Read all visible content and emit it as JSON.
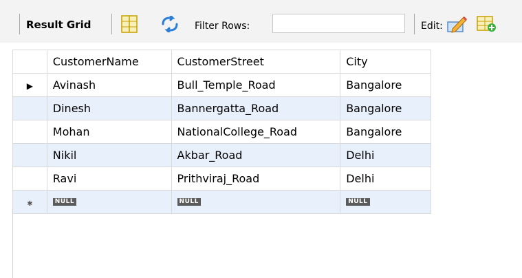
{
  "toolbar": {
    "result_grid_label": "Result Grid",
    "filter_rows_label": "Filter Rows:",
    "filter_value": "",
    "edit_label": "Edit:"
  },
  "grid": {
    "columns": [
      "CustomerName",
      "CustomerStreet",
      "City"
    ],
    "rows": [
      [
        "Avinash",
        "Bull_Temple_Road",
        "Bangalore"
      ],
      [
        "Dinesh",
        "Bannergatta_Road",
        "Bangalore"
      ],
      [
        "Mohan",
        "NationalCollege_Road",
        "Bangalore"
      ],
      [
        "Nikil",
        "Akbar_Road",
        "Delhi"
      ],
      [
        "Ravi",
        "Prithviraj_Road",
        "Delhi"
      ]
    ],
    "new_row": [
      "NULL",
      "NULL",
      "NULL"
    ],
    "current_row_marker": "▶",
    "new_row_marker": "✱"
  },
  "colors": {
    "alt_row": "#e8f0fb",
    "null_badge": "#5b5b5b"
  }
}
